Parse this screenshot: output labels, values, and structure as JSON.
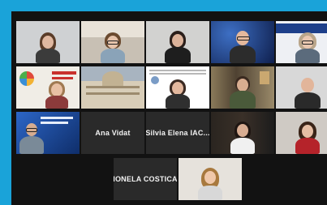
{
  "participants": [
    {
      "id": "p1",
      "kind": "video"
    },
    {
      "id": "p2",
      "kind": "video"
    },
    {
      "id": "p3",
      "kind": "video"
    },
    {
      "id": "p4",
      "kind": "video"
    },
    {
      "id": "p5",
      "kind": "video"
    },
    {
      "id": "p6",
      "kind": "video"
    },
    {
      "id": "p7",
      "kind": "video"
    },
    {
      "id": "p8",
      "kind": "video"
    },
    {
      "id": "p9",
      "kind": "video"
    },
    {
      "id": "p10",
      "kind": "video"
    },
    {
      "id": "p11",
      "kind": "video"
    },
    {
      "id": "p12",
      "kind": "name",
      "name": "Ana Vidat"
    },
    {
      "id": "p13",
      "kind": "name",
      "name": "Silvia Elena IAC..."
    },
    {
      "id": "p14",
      "kind": "video"
    },
    {
      "id": "p15",
      "kind": "video"
    },
    {
      "id": "p16",
      "kind": "name",
      "name": "IONELA COSTICA"
    },
    {
      "id": "p17",
      "kind": "video"
    }
  ],
  "colors": {
    "accent_frame": "#1aa3d9",
    "gallery_background": "#121212",
    "tile_background": "#2a2a2a"
  }
}
